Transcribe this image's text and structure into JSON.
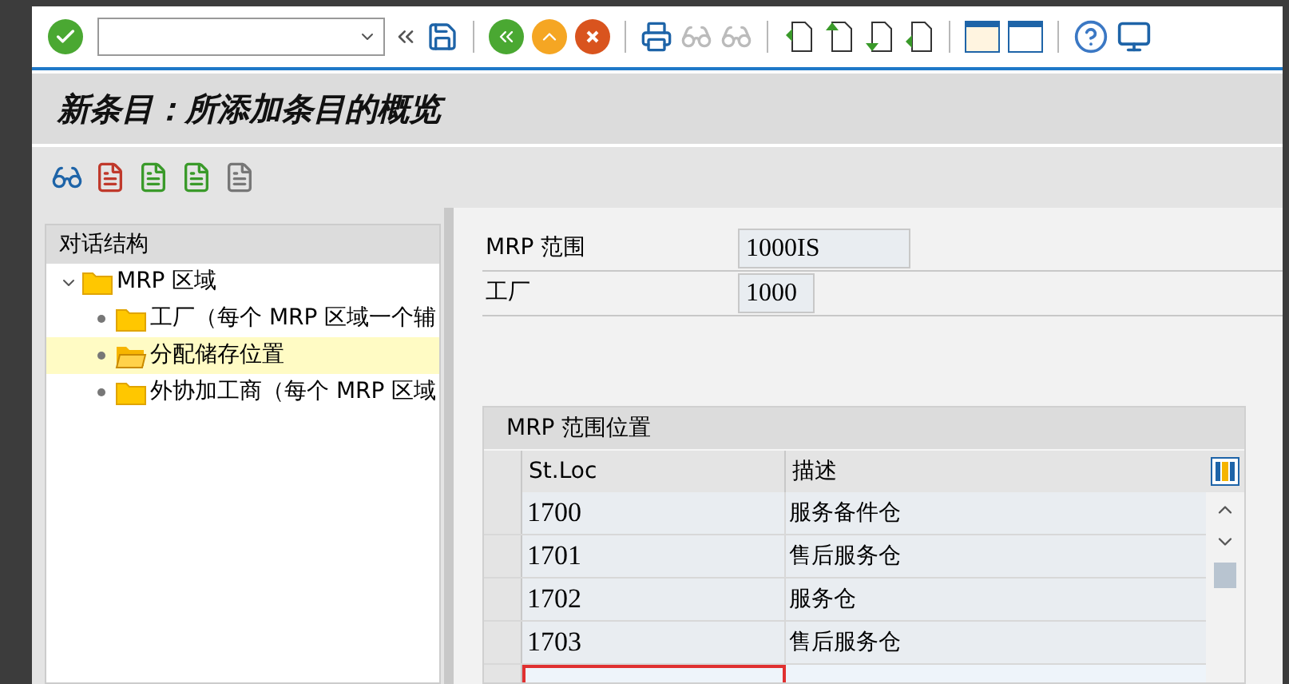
{
  "title": "新条目：所添加条目的概览",
  "tree": {
    "header": "对话结构",
    "items": [
      {
        "label": "MRP 区域",
        "expanded": true,
        "selected": false,
        "children": [
          {
            "label": "工厂（每个 MRP 区域一个辅",
            "selected": false
          },
          {
            "label": "分配储存位置",
            "selected": true
          },
          {
            "label": "外协加工商（每个 MRP 区域",
            "selected": false
          }
        ]
      }
    ]
  },
  "fields": [
    {
      "label": "MRP 范围",
      "value": "1000IS"
    },
    {
      "label": "工厂",
      "value": "1000"
    }
  ],
  "table": {
    "title": "MRP 范围位置",
    "columns": [
      "St.Loc",
      "描述"
    ],
    "rows": [
      {
        "st_loc": "1700",
        "description": "服务备件仓"
      },
      {
        "st_loc": "1701",
        "description": "售后服务仓"
      },
      {
        "st_loc": "1702",
        "description": "服务仓"
      },
      {
        "st_loc": "1703",
        "description": "售后服务仓"
      }
    ]
  }
}
